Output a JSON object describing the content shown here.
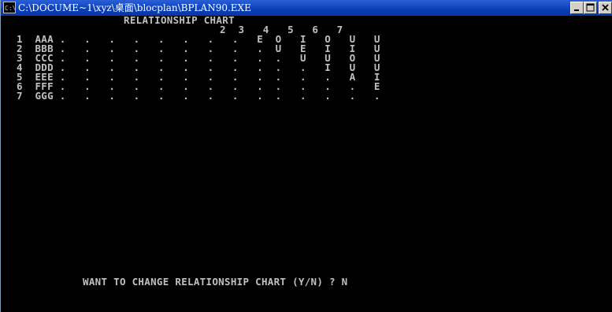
{
  "window": {
    "title": "C:\\DOCUME~1\\xyz\\桌面\\blocplan\\BPLAN90.EXE"
  },
  "icons": {
    "app": "console-icon",
    "minimize": "minimize-icon",
    "maximize": "maximize-icon",
    "close": "close-icon"
  },
  "console": {
    "chart_title": "RELATIONSHIP CHART",
    "header_row_1": "2  3   4   5   6   7",
    "header_row_2": "E  O   I   O   U   U",
    "rows": [
      "1  AAA .   .   .   .   .   .   .   .   E  O   I   O   U   U",
      "2  BBB .   .   .   .   .   .   .   .   .  U   E   I   I   U",
      "3  CCC .   .   .   .   .   .   .   .   .  .   U   U   O   U",
      "4  DDD .   .   .   .   .   .   .   .   .  .   .   I   U   U",
      "5  EEE .   .   .   .   .   .   .   .   .  .   .   .   A   I",
      "6  FFF .   .   .   .   .   .   .   .   .  .   .   .   .   E",
      "7  GGG .   .   .   .   .   .   .   .   .  .   .   .   .   ."
    ],
    "prompt": "WANT TO CHANGE RELATIONSHIP CHART (Y/N) ? N"
  },
  "colors": {
    "console_bg": "#000000",
    "console_text": "#c0c0c0",
    "titlebar": "#0a3fb8"
  }
}
